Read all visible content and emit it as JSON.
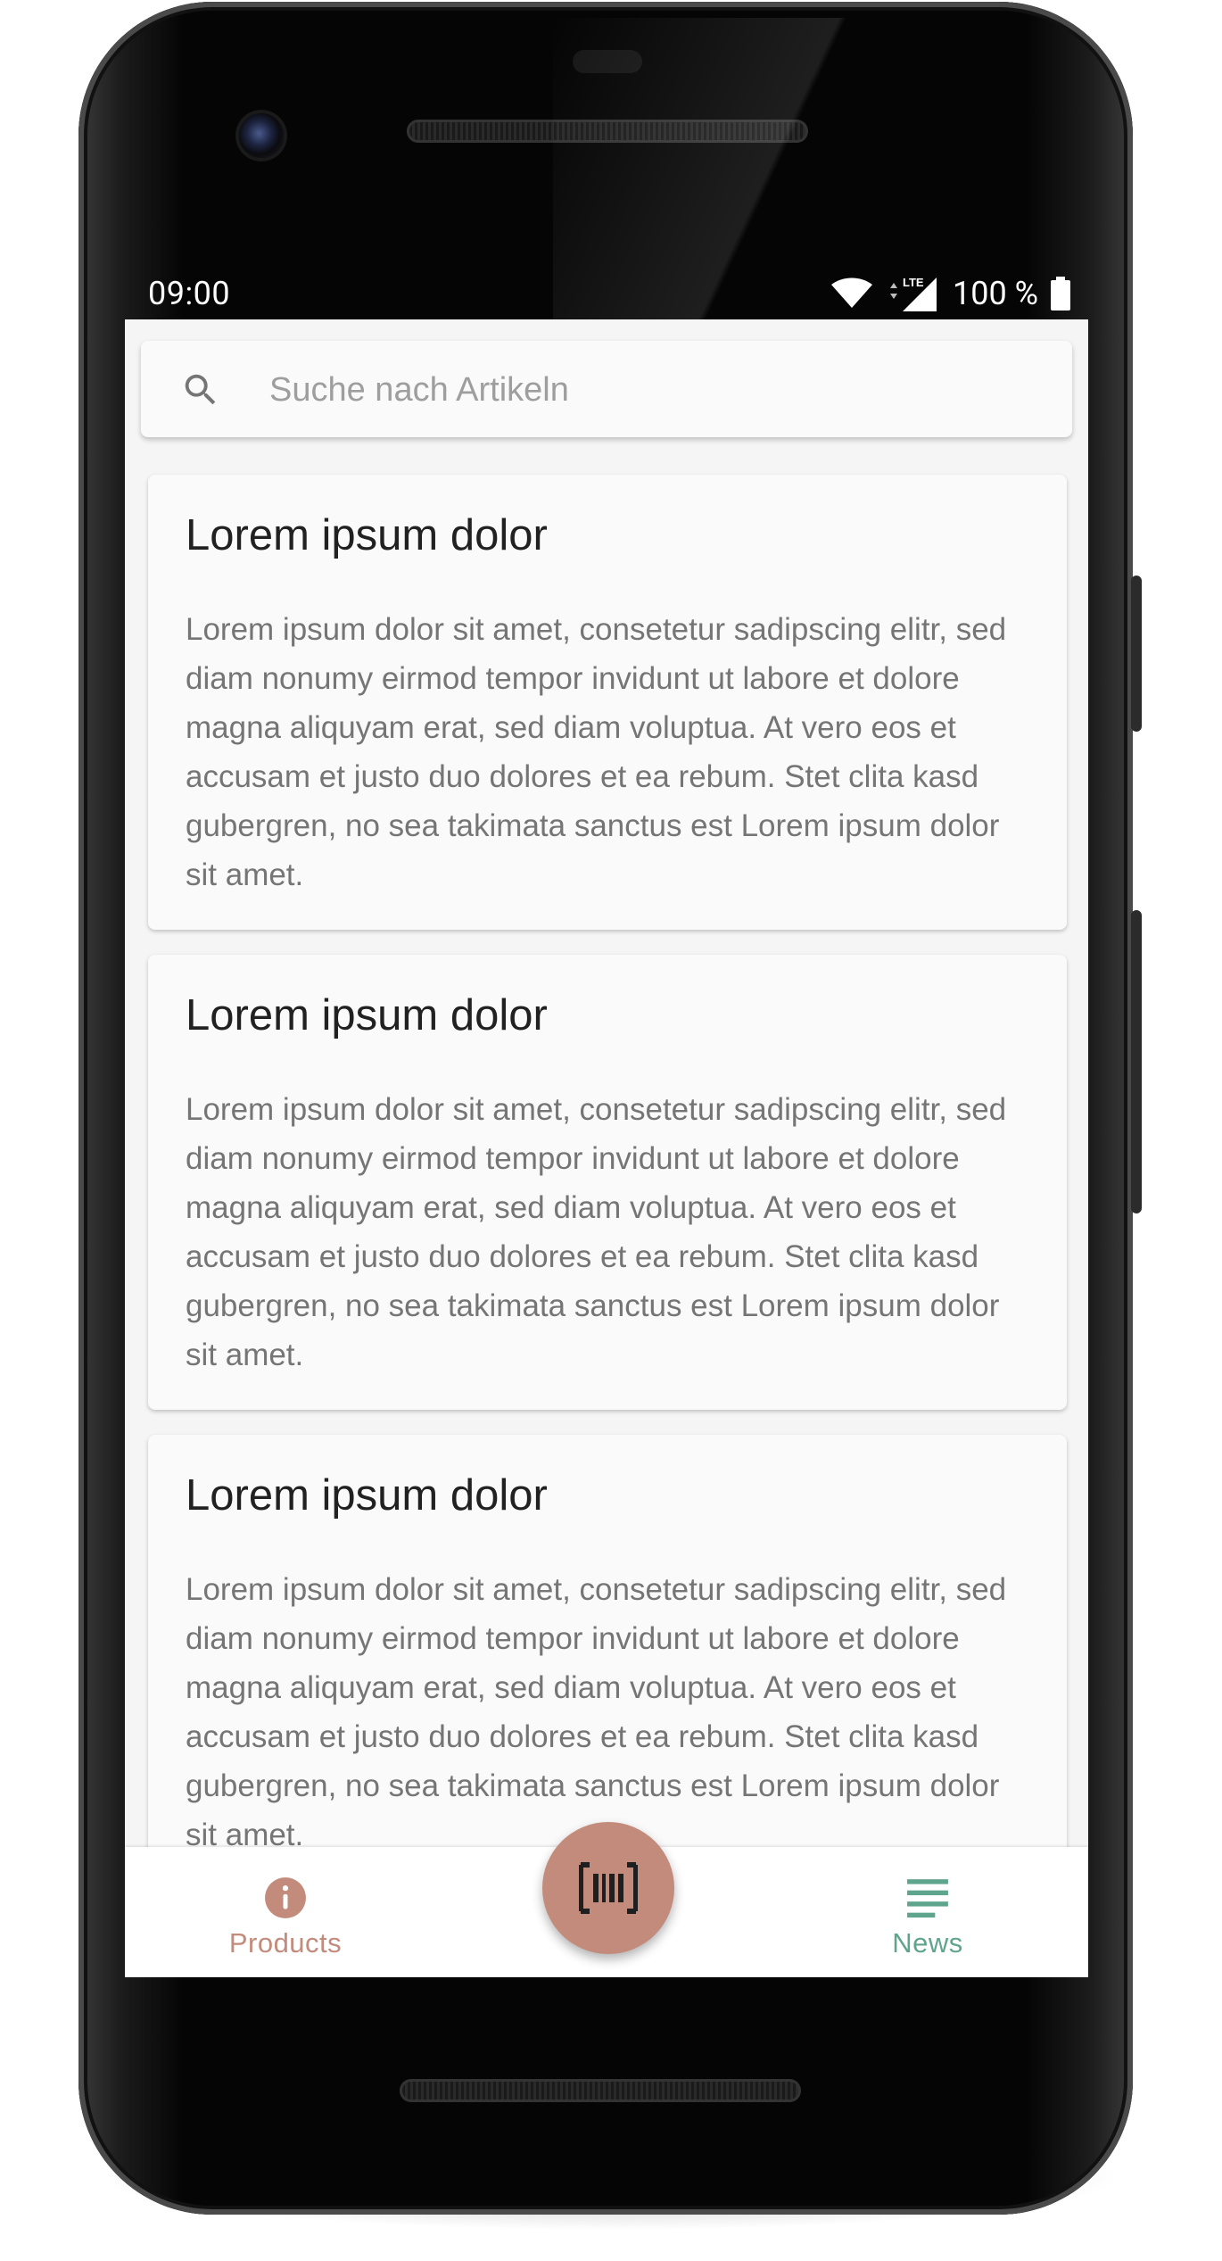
{
  "status_bar": {
    "time": "09:00",
    "network_label": "LTE",
    "battery": "100 %"
  },
  "search": {
    "placeholder": "Suche nach Artikeln",
    "value": "",
    "icon": "search-icon"
  },
  "articles": [
    {
      "title": "Lorem ipsum dolor",
      "body": "Lorem ipsum dolor sit amet, consetetur sadipscing elitr, sed diam nonumy eirmod tempor invidunt ut labore et dolore magna aliquyam erat, sed diam voluptua. At vero eos et accusam et justo duo dolores et ea rebum. Stet clita kasd gubergren, no sea takimata sanctus est Lorem ipsum dolor sit amet."
    },
    {
      "title": "Lorem ipsum dolor",
      "body": "Lorem ipsum dolor sit amet, consetetur sadipscing elitr, sed diam nonumy eirmod tempor invidunt ut labore et dolore magna aliquyam erat, sed diam voluptua. At vero eos et accusam et justo duo dolores et ea rebum. Stet clita kasd gubergren, no sea takimata sanctus est Lorem ipsum dolor sit amet."
    },
    {
      "title": "Lorem ipsum dolor",
      "body": "Lorem ipsum dolor sit amet, consetetur sadipscing elitr, sed diam nonumy eirmod tempor invidunt ut labore et dolore magna aliquyam erat, sed diam voluptua. At vero eos et accusam et justo duo dolores et ea rebum. Stet clita kasd gubergren, no sea takimata sanctus est Lorem ipsum dolor sit amet."
    }
  ],
  "bottom_nav": {
    "products": {
      "label": "Products",
      "icon": "info-icon",
      "color": "#c28b7b"
    },
    "news": {
      "label": "News",
      "icon": "news-icon",
      "color": "#5fa58e",
      "selected": true
    },
    "scan": {
      "icon": "barcode-icon",
      "color": "#c28b7b"
    }
  }
}
